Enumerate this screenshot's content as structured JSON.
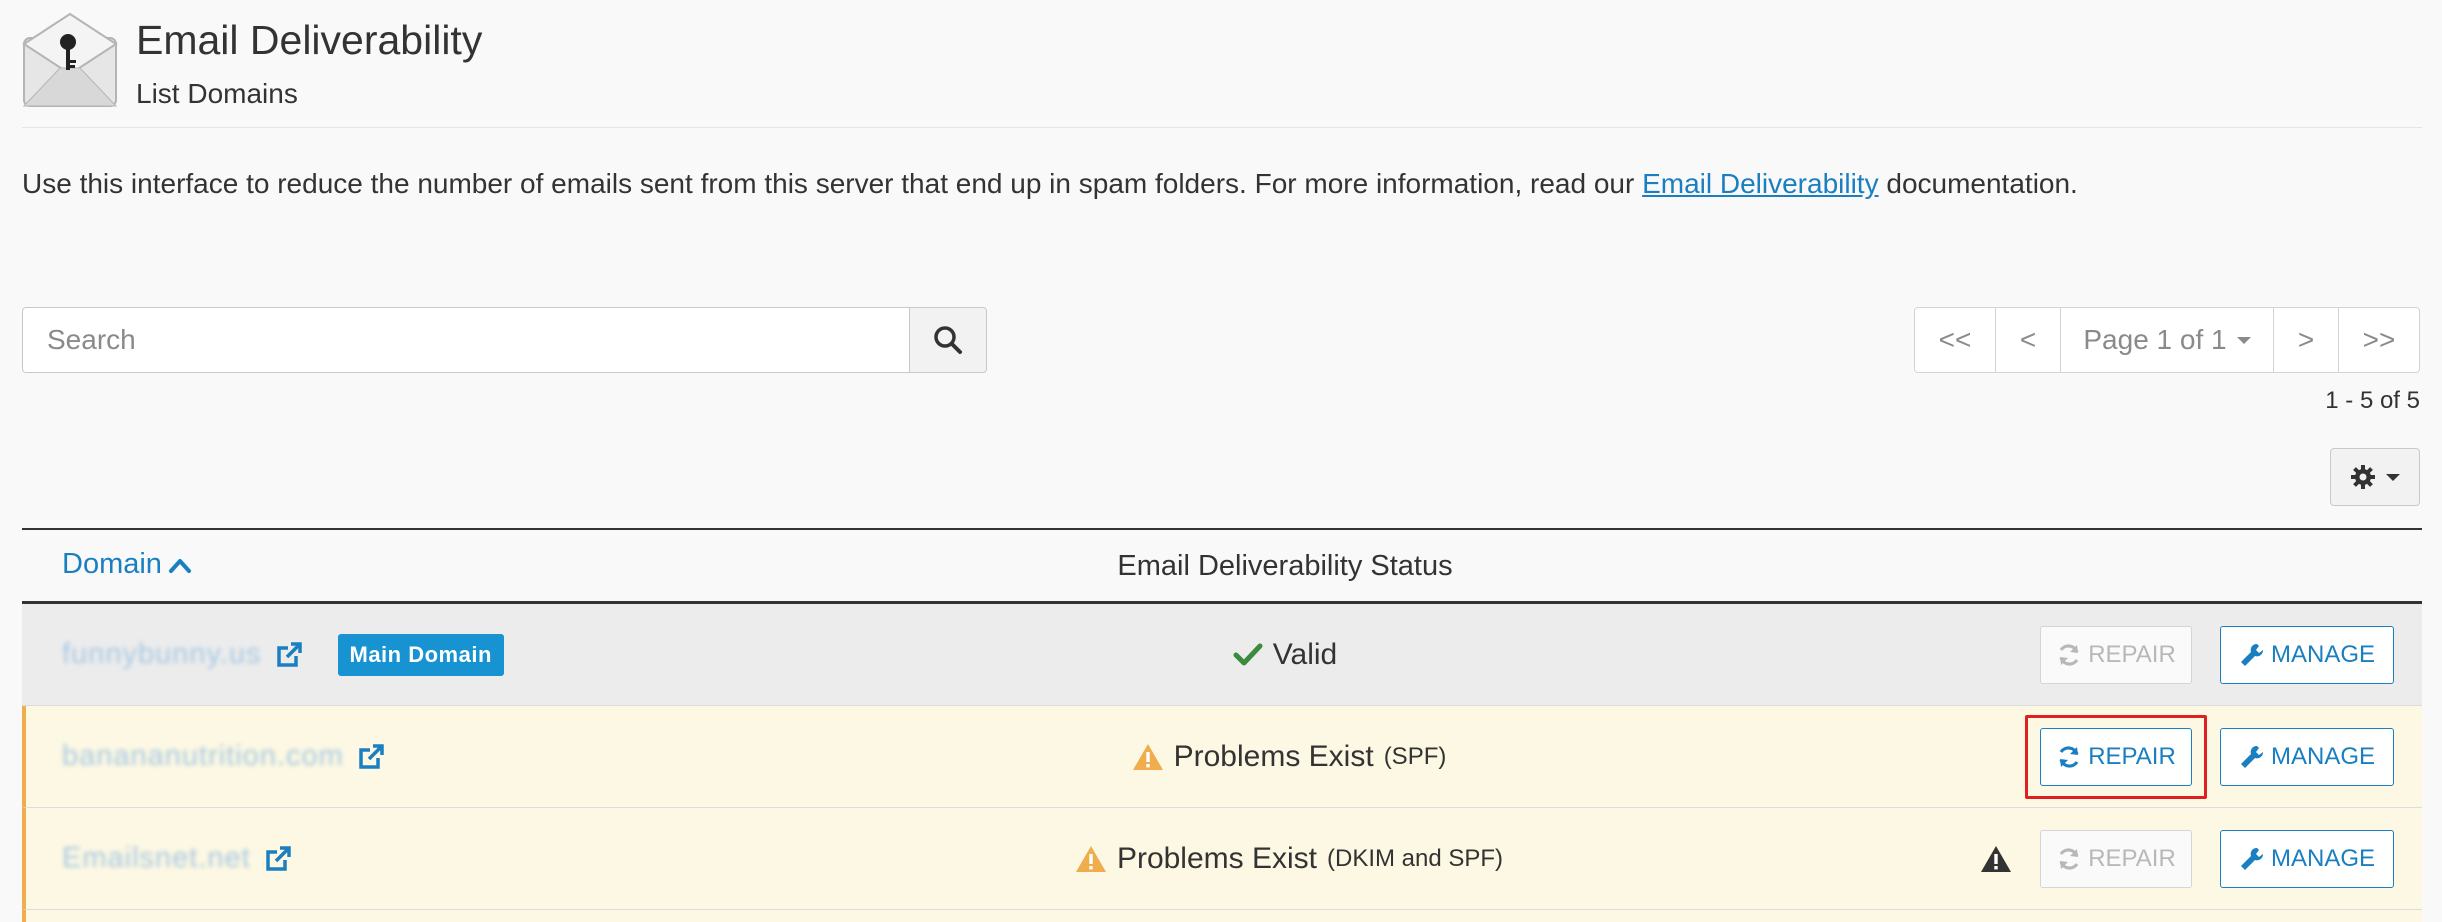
{
  "header": {
    "title": "Email Deliverability",
    "subtitle": "List Domains"
  },
  "intro": {
    "before": "Use this interface to reduce the number of emails sent from this server that end up in spam folders. For more information, read our ",
    "link": "Email Deliverability",
    "after": " documentation."
  },
  "search": {
    "placeholder": "Search"
  },
  "pagination": {
    "first": "<<",
    "prev": "<",
    "page_label": "Page 1 of 1",
    "next": ">",
    "last": ">>",
    "range": "1 - 5 of 5"
  },
  "table": {
    "col_domain": "Domain",
    "col_status": "Email Deliverability Status",
    "rows": [
      {
        "domain": "funnybunny.us",
        "badge": "Main Domain",
        "status": "Valid",
        "status_detail": "",
        "repair_label": "REPAIR",
        "manage_label": "MANAGE"
      },
      {
        "domain": "banananutrition.com",
        "status": "Problems Exist",
        "status_detail": "(SPF)",
        "repair_label": "REPAIR",
        "manage_label": "MANAGE"
      },
      {
        "domain": "Emailsnet.net",
        "status": "Problems Exist",
        "status_detail": "(DKIM and SPF)",
        "repair_label": "REPAIR",
        "manage_label": "MANAGE"
      }
    ]
  },
  "colors": {
    "link": "#1a7fc1",
    "valid": "#3c8b3c",
    "warning": "#f0ad4e",
    "badge": "#1793d1",
    "highlight": "#e02020"
  }
}
